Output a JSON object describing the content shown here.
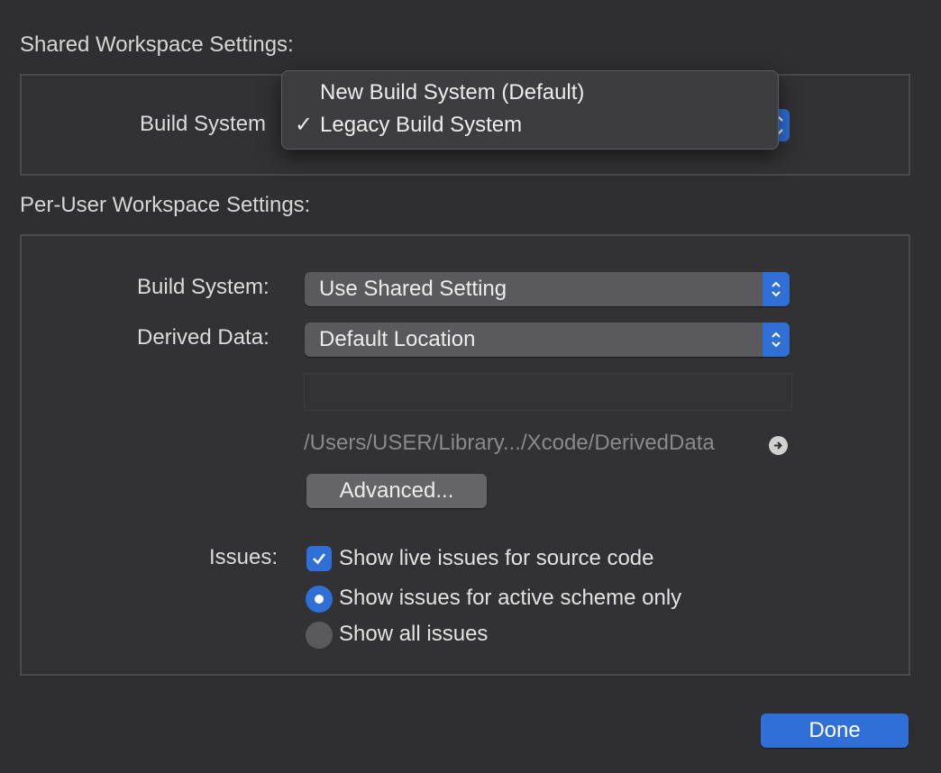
{
  "shared": {
    "title": "Shared Workspace Settings:",
    "build_system_label": "Build System",
    "menu": {
      "items": [
        {
          "label": "New Build System (Default)",
          "checked": false
        },
        {
          "label": "Legacy Build System",
          "checked": true
        }
      ],
      "check_glyph": "✓"
    }
  },
  "per_user": {
    "title": "Per-User Workspace Settings:",
    "build_system_label": "Build System:",
    "build_system_value": "Use Shared Setting",
    "derived_data_label": "Derived Data:",
    "derived_data_value": "Default Location",
    "derived_data_path": "/Users/USER/Library.../Xcode/DerivedData",
    "advanced_button": "Advanced...",
    "issues_label": "Issues:",
    "show_live_issues": {
      "label": "Show live issues for source code",
      "checked": true
    },
    "issue_scope": {
      "options": [
        {
          "label": "Show issues for active scheme only",
          "selected": true
        },
        {
          "label": "Show all issues",
          "selected": false
        }
      ]
    }
  },
  "footer": {
    "done_button": "Done"
  },
  "icons": {
    "popup_stepper": "chevron-updown-icon",
    "reveal": "arrow-circle-right-icon",
    "checkmark": "checkmark-icon"
  },
  "colors": {
    "background": "#2f2f31",
    "accent": "#2f6fd6",
    "group_border": "#4a4a4c"
  }
}
